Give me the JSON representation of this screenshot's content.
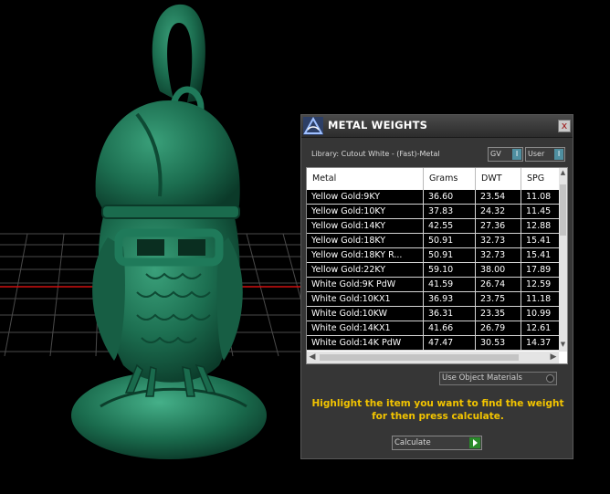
{
  "panel": {
    "title": "METAL WEIGHTS",
    "close_label": "x",
    "library_label": "Library: Cutout White - (Fast)-Metal",
    "toggles": [
      {
        "label": "GV",
        "knob": "I"
      },
      {
        "label": "User",
        "knob": "I"
      }
    ],
    "table": {
      "columns": [
        "Metal",
        "Grams",
        "DWT",
        "SPG"
      ],
      "rows": [
        [
          "Yellow Gold:9KY",
          "36.60",
          "23.54",
          "11.08"
        ],
        [
          "Yellow Gold:10KY",
          "37.83",
          "24.32",
          "11.45"
        ],
        [
          "Yellow Gold:14KY",
          "42.55",
          "27.36",
          "12.88"
        ],
        [
          "Yellow Gold:18KY",
          "50.91",
          "32.73",
          "15.41"
        ],
        [
          "Yellow Gold:18KY R...",
          "50.91",
          "32.73",
          "15.41"
        ],
        [
          "Yellow Gold:22KY",
          "59.10",
          "38.00",
          "17.89"
        ],
        [
          "White Gold:9K PdW",
          "41.59",
          "26.74",
          "12.59"
        ],
        [
          "White Gold:10KX1",
          "36.93",
          "23.75",
          "11.18"
        ],
        [
          "White Gold:10KW",
          "36.31",
          "23.35",
          "10.99"
        ],
        [
          "White Gold:14KX1",
          "41.66",
          "26.79",
          "12.61"
        ],
        [
          "White Gold:14K PdW",
          "47.47",
          "30.53",
          "14.37"
        ]
      ]
    },
    "object_materials_label": "Use Object Materials",
    "instructions": "Highlight the item you want to find the weight for then press calculate.",
    "calculate_label": "Calculate"
  },
  "colors": {
    "panel_bg": "#363636",
    "instruction_text": "#f2c400",
    "model_green": "#1f7a5a",
    "grid_line": "#5a5a5a",
    "axis_red": "#d01010"
  }
}
